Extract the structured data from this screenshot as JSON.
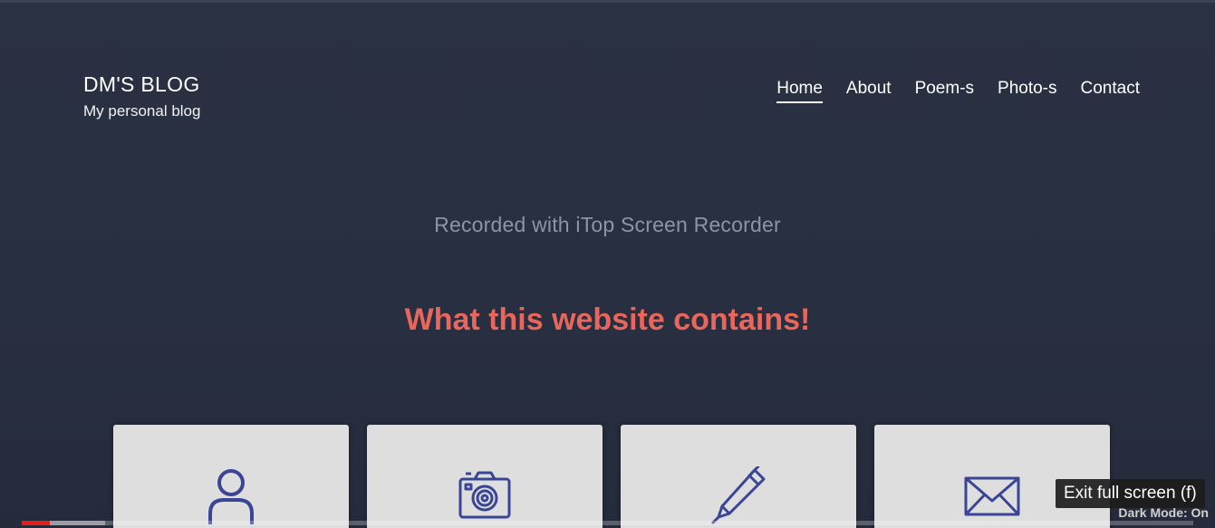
{
  "brand": {
    "title": "DM'S BLOG",
    "subtitle": "My personal blog"
  },
  "nav": {
    "items": [
      {
        "label": "Home",
        "active": true
      },
      {
        "label": "About"
      },
      {
        "label": "Poem-s"
      },
      {
        "label": "Photo-s"
      },
      {
        "label": "Contact"
      }
    ]
  },
  "watermark": "Recorded with iTop Screen Recorder",
  "section": {
    "heading": "What this website contains!"
  },
  "cards": [
    {
      "icon": "user-icon"
    },
    {
      "icon": "camera-icon"
    },
    {
      "icon": "pen-icon"
    },
    {
      "icon": "envelope-icon"
    }
  ],
  "player": {
    "progress_played_fraction": 0.024,
    "progress_loaded_fraction": 0.071,
    "tooltip": "Exit full screen (f)",
    "dark_mode_label": "Dark Mode: On"
  },
  "colors": {
    "background": "#282f40",
    "heading": "#e8665b",
    "card": "#dedede",
    "icon": "#3b4596",
    "progress": "#e41d1d"
  }
}
